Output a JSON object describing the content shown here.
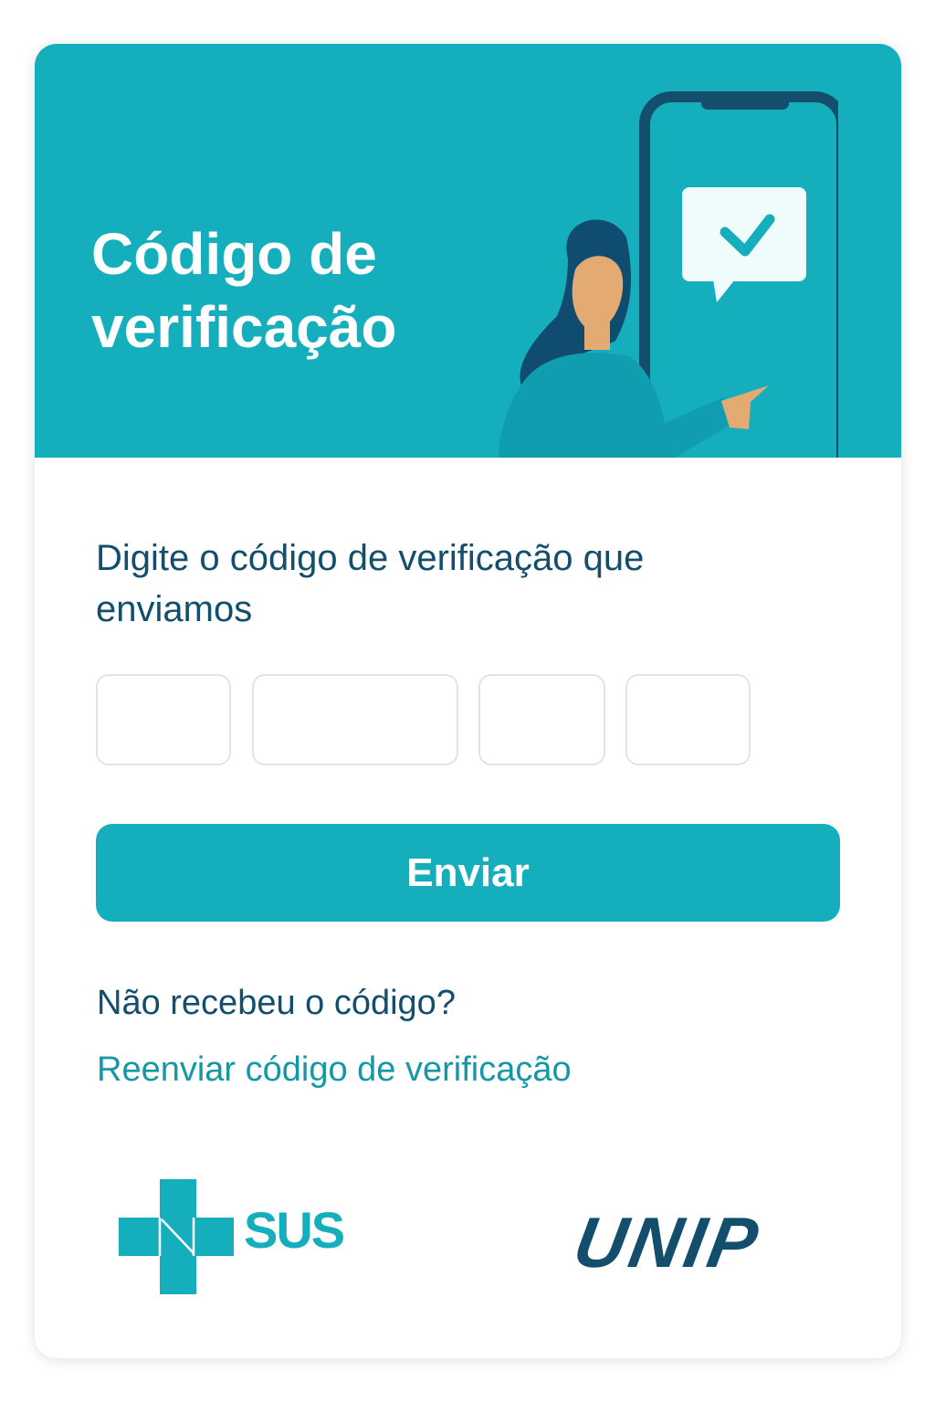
{
  "header": {
    "title": "Código de verificação"
  },
  "form": {
    "prompt": "Digite o código de verificação que enviamos",
    "code_boxes": [
      "",
      "",
      "",
      ""
    ],
    "submit_label": "Enviar"
  },
  "resend": {
    "question": "Não recebeu o código?",
    "link_label": "Reenviar código de verificação"
  },
  "logos": {
    "sus": "SUS",
    "unip": "UNIP"
  },
  "icons": {
    "message": "check-message-icon",
    "phone": "smartphone-icon"
  },
  "colors": {
    "primary": "#15aebc",
    "dark_text": "#134f6c",
    "link": "#1598a6"
  }
}
